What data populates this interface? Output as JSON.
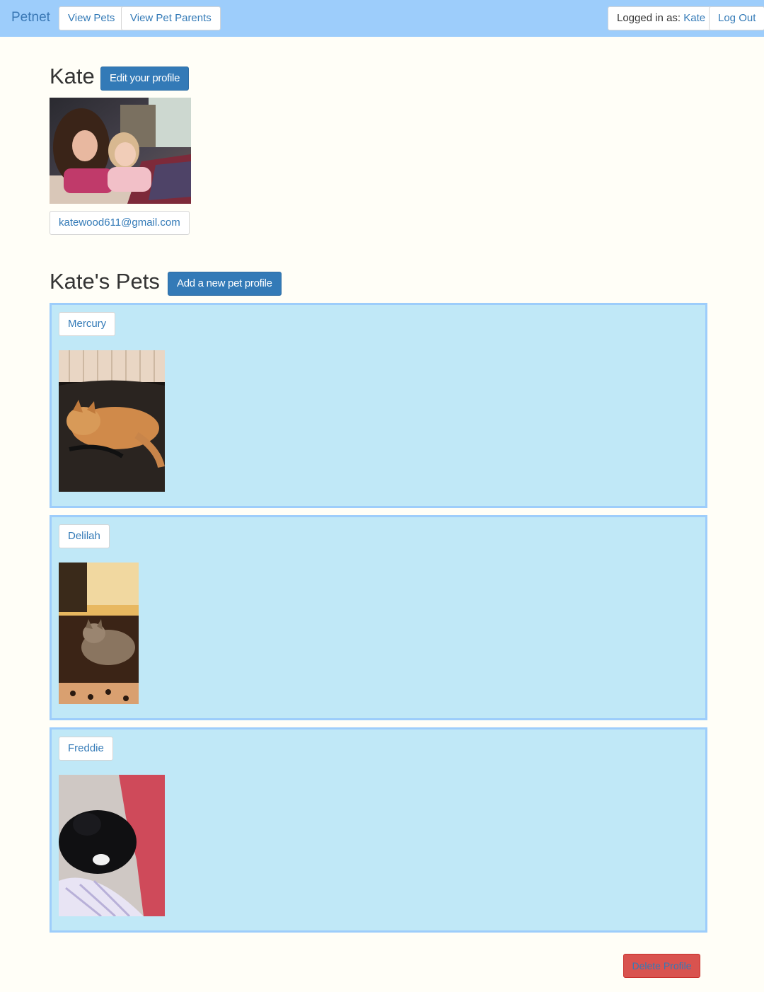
{
  "navbar": {
    "brand": "Petnet",
    "view_pets": "View Pets",
    "view_pet_parents": "View Pet Parents",
    "logged_in_label": "Logged in as:",
    "logged_in_user": "Kate",
    "log_out": "Log Out"
  },
  "profile": {
    "name": "Kate",
    "edit_button": "Edit your profile",
    "email": "katewood611@gmail.com"
  },
  "pets_section": {
    "title": "Kate's Pets",
    "add_button": "Add a new pet profile",
    "pets": [
      {
        "name": "Mercury"
      },
      {
        "name": "Delilah"
      },
      {
        "name": "Freddie"
      }
    ]
  },
  "delete_button": "Delete Profile",
  "colors": {
    "navbar": "#9dcdfb",
    "background": "#fffef7",
    "card": "#c0e8f7",
    "primary": "#337ab7",
    "danger": "#d9534f"
  }
}
